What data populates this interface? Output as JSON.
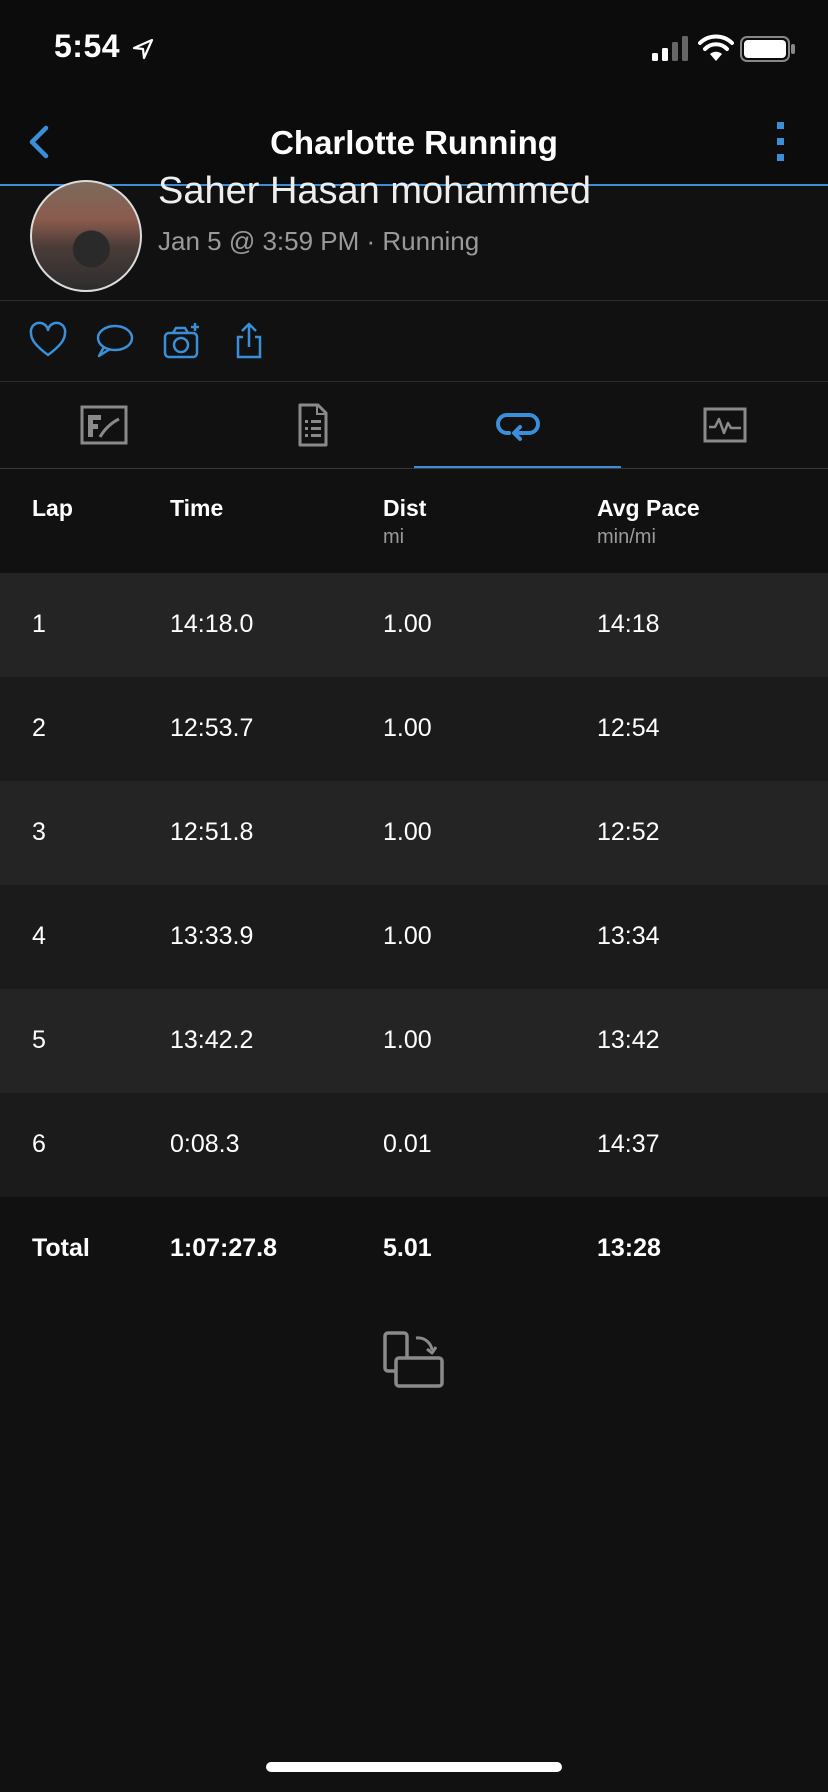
{
  "status_bar": {
    "time": "5:54"
  },
  "nav": {
    "title": "Charlotte Running"
  },
  "activity": {
    "user_name": "Saher Hasan mohammed",
    "meta": "Jan 5 @ 3:59 PM · Running"
  },
  "actions": [
    "heart-icon",
    "comment-icon",
    "camera-add-icon",
    "share-icon"
  ],
  "tabs": [
    {
      "name": "chart-tab",
      "active": false
    },
    {
      "name": "details-tab",
      "active": false
    },
    {
      "name": "laps-tab",
      "active": true
    },
    {
      "name": "graph-tab",
      "active": false
    }
  ],
  "laps_table": {
    "headers": [
      {
        "label": "Lap",
        "unit": ""
      },
      {
        "label": "Time",
        "unit": ""
      },
      {
        "label": "Dist",
        "unit": "mi"
      },
      {
        "label": "Avg Pace",
        "unit": "min/mi"
      }
    ],
    "rows": [
      [
        "1",
        "14:18.0",
        "1.00",
        "14:18"
      ],
      [
        "2",
        "12:53.7",
        "1.00",
        "12:54"
      ],
      [
        "3",
        "12:51.8",
        "1.00",
        "12:52"
      ],
      [
        "4",
        "13:33.9",
        "1.00",
        "13:34"
      ],
      [
        "5",
        "13:42.2",
        "1.00",
        "13:42"
      ],
      [
        "6",
        "0:08.3",
        "0.01",
        "14:37"
      ]
    ],
    "total": [
      "Total",
      "1:07:27.8",
      "5.01",
      "13:28"
    ]
  },
  "colors": {
    "accent": "#3a8fd8",
    "background": "#111111",
    "row_alt": "#242424"
  }
}
